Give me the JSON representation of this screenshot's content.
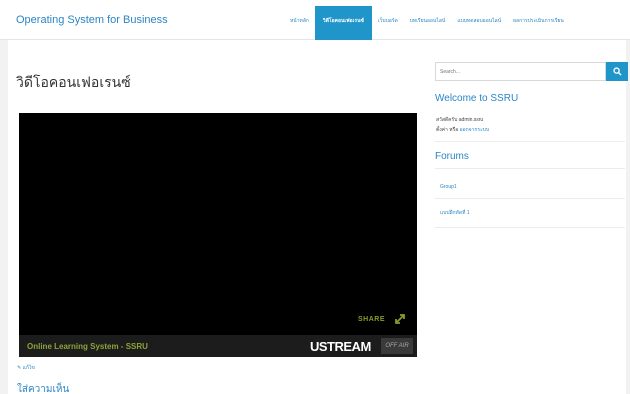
{
  "header": {
    "brand": "Operating System for Business",
    "nav": [
      {
        "label": "หน้าหลัก",
        "active": false
      },
      {
        "label": "วิดีโอคอนเฟอเรนซ์",
        "active": true
      },
      {
        "label": "เว็บบอร์ด",
        "active": false
      },
      {
        "label": "บทเรียนออนไลน์",
        "active": false
      },
      {
        "label": "แบบทดสอบออนไลน์",
        "active": false
      },
      {
        "label": "ผลการประเมินการเรียน",
        "active": false
      }
    ]
  },
  "main": {
    "title": "วิดีโอคอนเฟอเรนซ์",
    "video": {
      "share_label": "SHARE",
      "caption": "Online Learning System - SSRU",
      "provider": "USTREAM",
      "status": "OFF AIR"
    },
    "edit_link": "แก้ไข",
    "comment_heading": "ใส่ความเห็น"
  },
  "sidebar": {
    "search_placeholder": "Search...",
    "welcome_heading": "Welcome to SSRU",
    "welcome_line1": "สวัสดีครับ admin.ssru",
    "welcome_line2_prefix": "ตั้งค่า หรือ",
    "logout_link": "ออกจากระบบ",
    "forums_heading": "Forums",
    "forum_links": [
      "Group1",
      "แบบฝึกหัดที่ 1"
    ]
  },
  "colors": {
    "accent": "#1f95c9",
    "link": "#2b86c5",
    "caption_green": "#8ba33a"
  }
}
